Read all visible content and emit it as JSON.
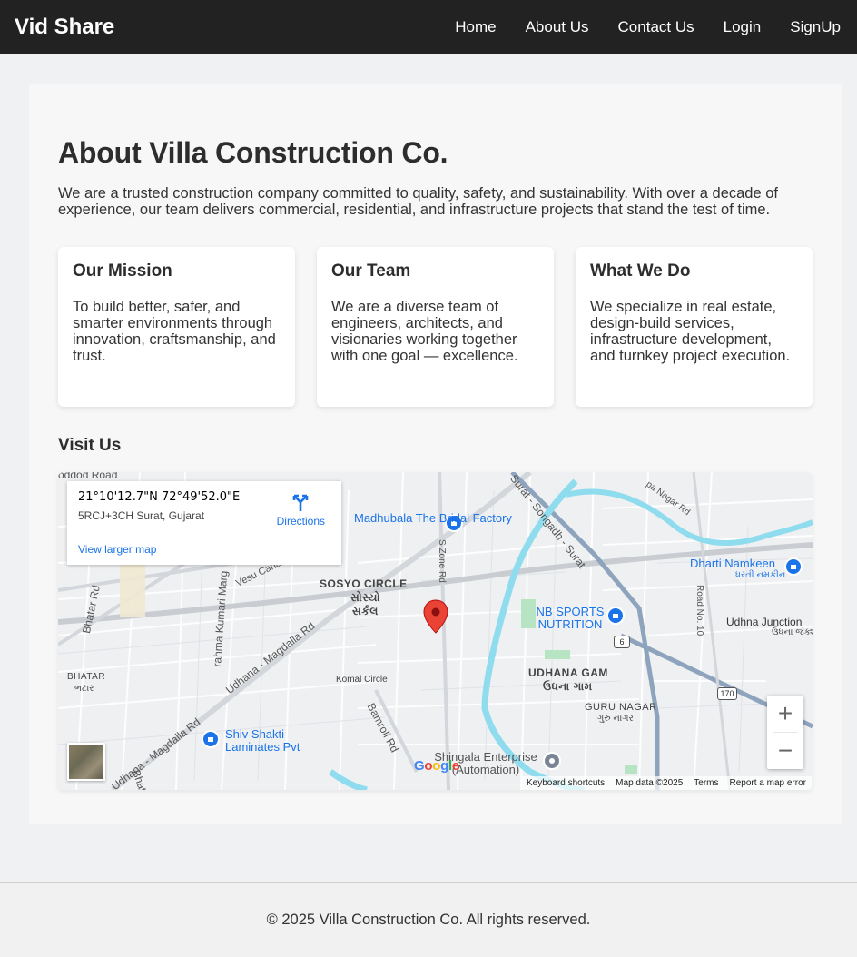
{
  "nav": {
    "brand": "Vid Share",
    "links": [
      "Home",
      "About Us",
      "Contact Us",
      "Login",
      "SignUp"
    ]
  },
  "about": {
    "title": "About Villa Construction Co.",
    "intro": "We are a trusted construction company committed to quality, safety, and sustainability. With over a decade of experience, our team delivers commercial, residential, and infrastructure projects that stand the test of time."
  },
  "cards": [
    {
      "title": "Our Mission",
      "text": "To build better, safer, and smarter environments through innovation, craftsmanship, and trust."
    },
    {
      "title": "Our Team",
      "text": "We are a diverse team of engineers, architects, and visionaries working together with one goal — excellence."
    },
    {
      "title": "What We Do",
      "text": "We specialize in real estate, design-build services, infrastructure development, and turnkey project execution."
    }
  ],
  "visit": {
    "title": "Visit Us"
  },
  "map": {
    "coords": "21°10'12.7\"N 72°49'52.0\"E",
    "plus_code": "5RCJ+3CH Surat, Gujarat",
    "larger_map": "View larger map",
    "directions": "Directions",
    "labels": {
      "sosyo": "SOSYO CIRCLE",
      "sosyo_gu": "સોસ્યો",
      "sosyo_gu2": "સર્કલ",
      "udhana_gam": "UDHANA GAM",
      "udhana_gam_gu": "ઉધના ગામ",
      "guru_nagar": "GURU NAGAR",
      "guru_nagar_gu": "ગુરુ નાગર",
      "bhatar": "BHATAR",
      "bhatar_gu": "ભટાર",
      "komal": "Komal Circle",
      "udhana_junction": "Udhna Junction",
      "udhana_junction_gu": "ઉધના જંક્શન",
      "bhatar_rd": "Bhatar Rd",
      "udhana_magdalla": "Udhana - Magdalla Rd",
      "udhana_magdalla2": "Udhana - Magdalla Rd",
      "bamroli": "Bamroli Rd",
      "s_zone": "S Zone Rd",
      "surat_songadh": "Surat - Songadh - Surat",
      "road_no10": "Road No. 10",
      "vesu_canal": "Vesu Canal",
      "kumari_marg": "rahma Kumari Marg",
      "oddod": "oddod Road",
      "nagar_rd": "pa Nagar Rd",
      "bhat": "Bhat",
      "shield_6": "6",
      "shield_170": "170"
    },
    "poi": {
      "madhubala": "Madhubala The Bridal Factory",
      "nb_sports": "NB SPORTS NUTRITION",
      "dharti": "Dharti Namkeen",
      "dharti_gu": "ધરતી નમકીન",
      "shiv_shakti": "Shiv Shakti Laminates Pvt",
      "shingala": "Shingala Enterprise (Automation)"
    },
    "attribution": {
      "keyboard": "Keyboard shortcuts",
      "data": "Map data ©2025",
      "terms": "Terms",
      "report": "Report a map error"
    },
    "google": "Google",
    "zoom_in": "+",
    "zoom_out": "−"
  },
  "footer": {
    "text": "© 2025 Villa Construction Co. All rights reserved."
  },
  "colors": {
    "nav_bg": "#222222",
    "accent": "#1a73e8",
    "pin": "#ea4335"
  }
}
